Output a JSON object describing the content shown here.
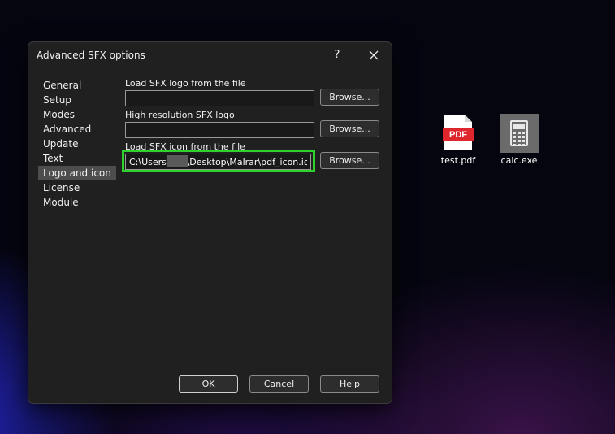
{
  "desktop": {
    "icons": [
      {
        "label": "test.pdf",
        "icon": "pdf-file-icon",
        "badge": "PDF"
      },
      {
        "label": "calc.exe",
        "icon": "calculator-icon"
      }
    ]
  },
  "dialog": {
    "title": "Advanced SFX options",
    "help_glyph": "?",
    "nav_items": [
      "General",
      "Setup",
      "Modes",
      "Advanced",
      "Update",
      "Text",
      "Logo and icon",
      "License",
      "Module"
    ],
    "selected_nav": "Logo and icon",
    "logo_field": {
      "label": "Load SFX logo from the file",
      "value": "",
      "browse": "Browse..."
    },
    "hires_field": {
      "label_accel": "H",
      "label_rest": "igh resolution SFX logo",
      "value": "",
      "browse": "Browse..."
    },
    "icon_field": {
      "label": "Load SFX icon from the file",
      "value": "C:\\Users\\      \\Desktop\\Malrar\\pdf_icon.ico",
      "browse": "Browse..."
    },
    "buttons": {
      "ok": "OK",
      "cancel": "Cancel",
      "help": "Help"
    },
    "highlight_color": "#2ed12e"
  }
}
